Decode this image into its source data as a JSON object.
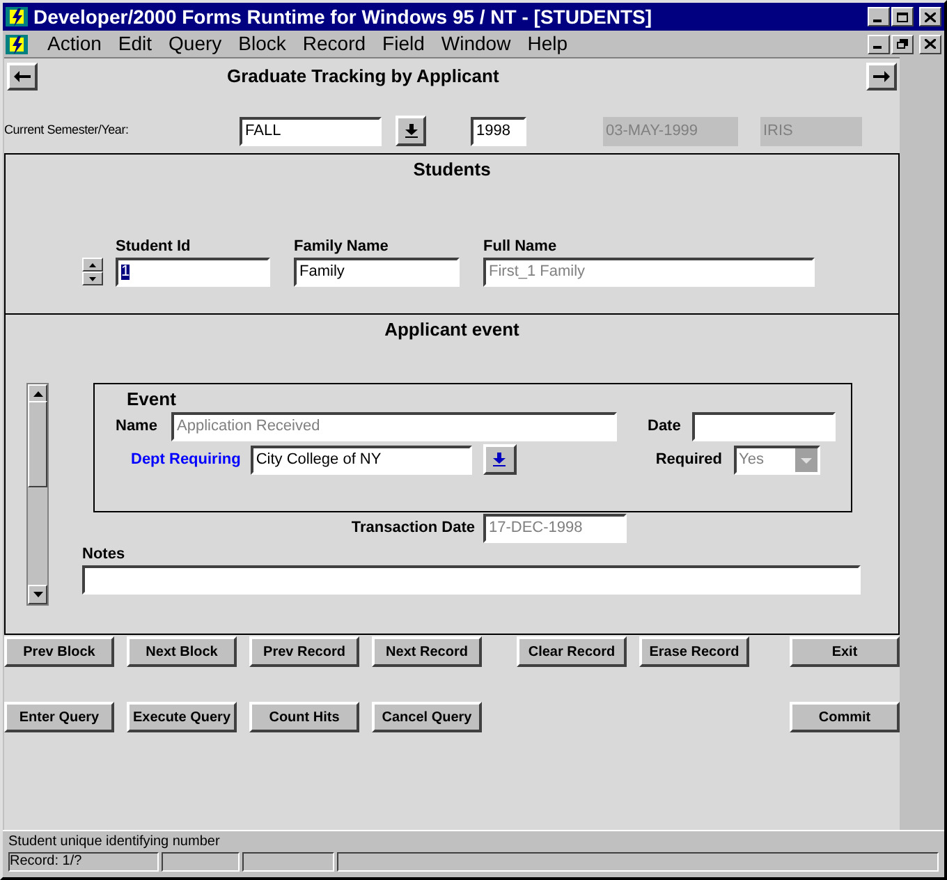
{
  "window": {
    "title": "Developer/2000 Forms Runtime for Windows 95 / NT - [STUDENTS]"
  },
  "menu": [
    "Action",
    "Edit",
    "Query",
    "Block",
    "Record",
    "Field",
    "Window",
    "Help"
  ],
  "form_title": "Graduate Tracking by Applicant",
  "semester": {
    "label": "Current Semester/Year:",
    "fields": [
      {
        "kind": "field",
        "value": "FALL",
        "disabled": false,
        "dropdown": true
      },
      {
        "kind": "field",
        "value": "1998",
        "disabled": false,
        "dropdown": false
      },
      {
        "kind": "display",
        "value": "03-MAY-1999",
        "disabled": true,
        "dropdown": false
      },
      {
        "kind": "display",
        "value": "IRIS",
        "disabled": true,
        "dropdown": false
      }
    ]
  },
  "students": {
    "title": "Students",
    "fields": [
      {
        "label": "Student Id",
        "value": "1",
        "disabled": false,
        "text_selected": true
      },
      {
        "label": "Family Name",
        "value": "Family",
        "disabled": false,
        "text_selected": false
      },
      {
        "label": "Full Name",
        "value": "First_1  Family",
        "disabled": true,
        "text_selected": false
      }
    ]
  },
  "applicant_event": {
    "title": "Applicant event",
    "event": {
      "title": "Event",
      "name": {
        "label": "Name",
        "value": "Application Received",
        "disabled": true
      },
      "date": {
        "label": "Date"
      },
      "dept": {
        "label": "Dept Requiring",
        "value": "City College of NY"
      },
      "required": {
        "label": "Required",
        "value": "Yes",
        "disabled": true
      }
    },
    "transaction_date": {
      "label": "Transaction Date",
      "value": "17-DEC-1998",
      "disabled": true
    },
    "notes": {
      "label": "Notes"
    }
  },
  "button_rows": [
    [
      [
        "Prev Block",
        "Next Block",
        "Prev Record",
        "Next Record"
      ],
      [
        "Clear Record",
        "Erase Record"
      ],
      [
        "Exit"
      ]
    ],
    [
      [
        "Enter Query",
        "Execute Query",
        "Count Hits",
        "Cancel Query"
      ],
      [
        "Commit"
      ]
    ]
  ],
  "status_bar": {
    "message": "Student unique identifying number",
    "record": "Record: 1/?"
  }
}
